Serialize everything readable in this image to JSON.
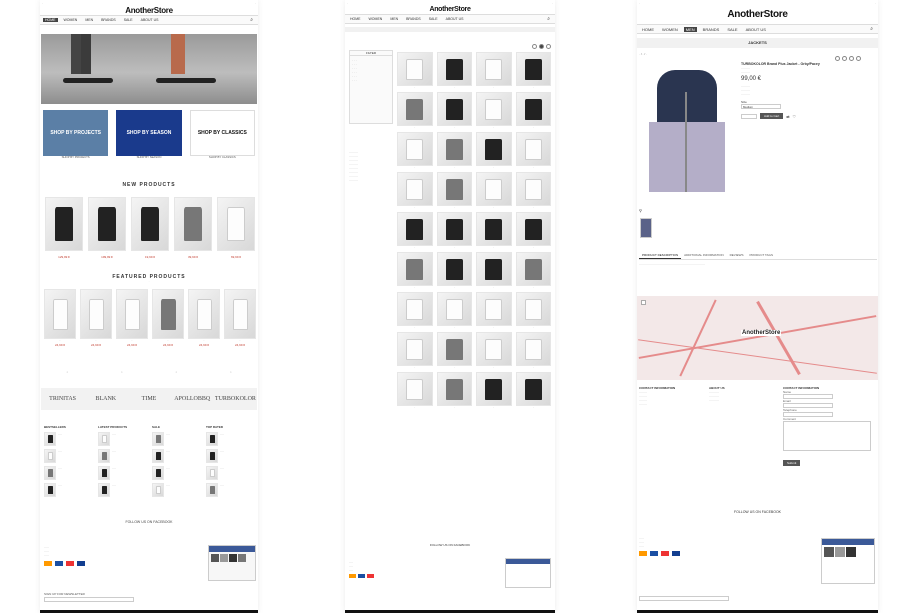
{
  "brand": {
    "name": "AnotherStore"
  },
  "nav": {
    "items": [
      "HOME",
      "WOMEN",
      "MEN",
      "BRANDS",
      "SALE",
      "ABOUT US"
    ],
    "active_p1": "HOME",
    "active_p3": "MEN"
  },
  "page1": {
    "promo_banners": [
      {
        "label": "SHOP BY PROJECTS",
        "caption": "SHOP BY PROJECTS",
        "color": "#5b7fa6"
      },
      {
        "label": "SHOP BY SEASON",
        "caption": "SHOP BY SEASON",
        "color": "#1a3a8c"
      },
      {
        "label": "SHOP BY CLASSICS",
        "caption": "SHOP BY CLASSICS",
        "color": "#ffffff"
      }
    ],
    "new_products_title": "NEW PRODUCTS",
    "new_products": [
      {
        "price": "129,99 €",
        "tone": "dark"
      },
      {
        "price": "199,99 €",
        "tone": "dark"
      },
      {
        "price": "19,99 €",
        "tone": "dark"
      },
      {
        "price": "39,99 €",
        "tone": "mid"
      },
      {
        "price": "69,99 €",
        "tone": "wht"
      }
    ],
    "featured_title": "FEATURED PRODUCTS",
    "featured": [
      {
        "price": "24,99 €",
        "tone": "wht"
      },
      {
        "price": "24,99 €",
        "tone": "wht"
      },
      {
        "price": "24,99 €",
        "tone": "wht"
      },
      {
        "price": "24,99 €",
        "tone": "mid"
      },
      {
        "price": "24,99 €",
        "tone": "wht"
      },
      {
        "price": "24,99 €",
        "tone": "wht"
      }
    ],
    "brands": [
      "TRINITAS",
      "BLANK",
      "TIME",
      "APOLLOBBQ",
      "TURBOKOLOR"
    ],
    "columns": [
      "BESTSELLERS",
      "LATEST PRODUCTS",
      "SALE",
      "TOP RATED"
    ],
    "follow": "FOLLOW US ON FACEBOOK",
    "newsletter": "SIGN UP FOR NEWSLETTER"
  },
  "page2": {
    "sidebar_title": "FILTER",
    "footer_follow": "FOLLOW US ON FACEBOOK"
  },
  "page3": {
    "section": "JACKETS",
    "product_title": "TURBOKOLOR Brand Plus Jacket - Orby/Pacey",
    "price": "99,00 €",
    "add_to_cart": "Add to Cart",
    "size_label": "Size",
    "size_value": "Medium",
    "tabs": [
      "PRODUCT DESCRIPTION",
      "ADDITIONAL INFORMATION",
      "REVIEWS",
      "PRODUCT TAGS"
    ],
    "contact_title": "CONTACT INFORMATION",
    "about_title": "ABOUT US",
    "form_title": "CONTACT INFORMATION",
    "form_fields": [
      "Name",
      "Email",
      "Telephone",
      "Comment"
    ],
    "submit": "Submit",
    "follow": "FOLLOW US ON FACEBOOK",
    "map_logo": "AnotherStore"
  }
}
